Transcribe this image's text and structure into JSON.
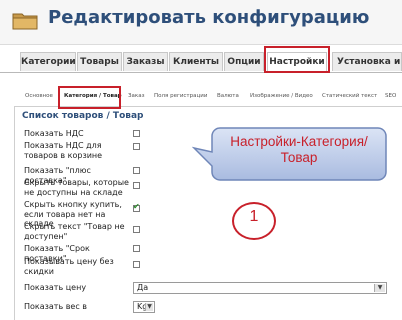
{
  "header": {
    "title": "Редактировать конфигурацию",
    "icon": "folder-icon"
  },
  "tabs": [
    {
      "label": "Категории"
    },
    {
      "label": "Товары"
    },
    {
      "label": "Заказы"
    },
    {
      "label": "Клиенты"
    },
    {
      "label": "Опции"
    },
    {
      "label": "Настройки",
      "active": true
    },
    {
      "label": "Установка и Обн"
    }
  ],
  "subtabs": [
    {
      "label": "Основное"
    },
    {
      "label": "Категория / Товар",
      "active": true
    },
    {
      "label": "Заказ"
    },
    {
      "label": "Поля регистрации"
    },
    {
      "label": "Валюта"
    },
    {
      "label": "Изображение / Видео"
    },
    {
      "label": "Статический текст"
    },
    {
      "label": "SEO"
    }
  ],
  "section": {
    "title": "Список товаров / Товар"
  },
  "settings": [
    {
      "label": "Показать НДС",
      "checked": false
    },
    {
      "label": "Показать НДС для товаров в корзине",
      "checked": false
    },
    {
      "label": "Показать \"плюс доставка\"",
      "checked": false
    },
    {
      "label": "Скрыть товары, которые не доступны на складе",
      "checked": false
    },
    {
      "label": "Скрыть кнопку купить, если товара нет на складе",
      "checked": true
    },
    {
      "label": "Скрыть текст \"Товар не доступен\"",
      "checked": false
    },
    {
      "label": "Показать \"Срок поставки\"",
      "checked": false
    },
    {
      "label": "Показывать цену без скидки",
      "checked": false
    }
  ],
  "selects": {
    "price": {
      "label": "Показать цену",
      "value": "Да"
    },
    "weight": {
      "label": "Показать вес в",
      "value": "Kg"
    }
  },
  "callout": {
    "text": "Настройки-Категория/Товар"
  },
  "step": {
    "number": "1"
  },
  "colors": {
    "accent": "#c8202a",
    "title": "#2e4f7a",
    "callout_fill": "#b6c6e6"
  }
}
